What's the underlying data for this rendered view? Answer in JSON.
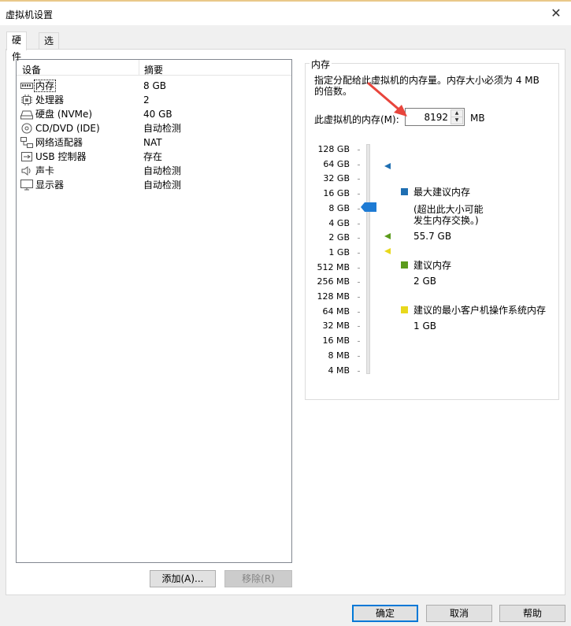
{
  "window": {
    "title": "虚拟机设置",
    "close_glyph": "✕"
  },
  "tabs": [
    {
      "label": "硬件",
      "active": true
    },
    {
      "label": "选项",
      "active": false
    }
  ],
  "devices": {
    "columns": [
      "设备",
      "摘要"
    ],
    "rows": [
      {
        "name": "内存",
        "summary": "8 GB",
        "icon": "memory-icon",
        "selected": true
      },
      {
        "name": "处理器",
        "summary": "2",
        "icon": "processor-icon"
      },
      {
        "name": "硬盘 (NVMe)",
        "summary": "40 GB",
        "icon": "hard-disk-icon"
      },
      {
        "name": "CD/DVD (IDE)",
        "summary": "自动检测",
        "icon": "cd-dvd-icon"
      },
      {
        "name": "网络适配器",
        "summary": "NAT",
        "icon": "network-adapter-icon"
      },
      {
        "name": "USB 控制器",
        "summary": "存在",
        "icon": "usb-icon"
      },
      {
        "name": "声卡",
        "summary": "自动检测",
        "icon": "speaker-icon"
      },
      {
        "name": "显示器",
        "summary": "自动检测",
        "icon": "monitor-icon"
      }
    ]
  },
  "buttons": {
    "add": "添加(A)...",
    "remove": "移除(R)",
    "ok": "确定",
    "cancel": "取消",
    "help": "帮助"
  },
  "memory": {
    "group_title": "内存",
    "description": "指定分配给此虚拟机的内存量。内存大小必须为 4 MB 的倍数。",
    "field_label": "此虚拟机的内存(M):",
    "value": "8192",
    "unit": "MB",
    "scale_labels": [
      "128 GB",
      "64 GB",
      "32 GB",
      "16 GB",
      "8 GB",
      "4 GB",
      "2 GB",
      "1 GB",
      "512 MB",
      "256 MB",
      "128 MB",
      "64 MB",
      "32 MB",
      "16 MB",
      "8 MB",
      "4 MB"
    ],
    "slider_level_label": "8 GB",
    "legend": {
      "max": {
        "title": "最大建议内存",
        "note_line1": "(超出此大小可能",
        "note_line2": "发生内存交换。)",
        "value": "55.7 GB",
        "color": "#1f6fb2"
      },
      "recommended": {
        "title": "建议内存",
        "value": "2 GB",
        "color": "#5b9b1c"
      },
      "min_guest": {
        "title": "建议的最小客户机操作系统内存",
        "value": "1 GB",
        "color": "#e8d81c"
      }
    },
    "slider_color": "#1e7bd4",
    "annotation_color": "#e8453c"
  }
}
